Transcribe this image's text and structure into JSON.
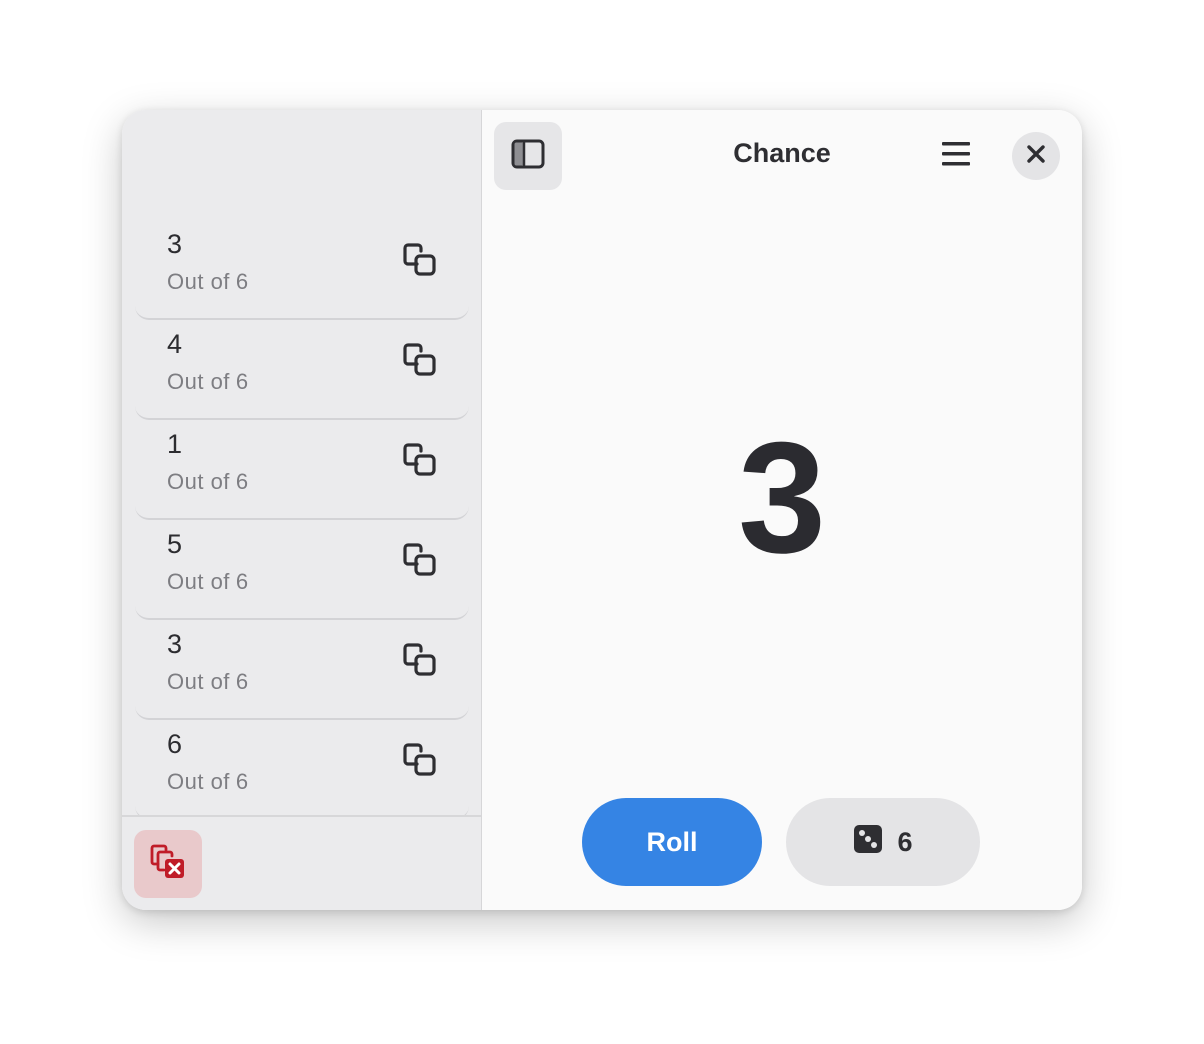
{
  "app": {
    "title": "Chance"
  },
  "sidebar": {
    "history": [
      {
        "value": "3",
        "out_of_label": "Out of",
        "max": "6"
      },
      {
        "value": "4",
        "out_of_label": "Out of",
        "max": "6"
      },
      {
        "value": "1",
        "out_of_label": "Out of",
        "max": "6"
      },
      {
        "value": "5",
        "out_of_label": "Out of",
        "max": "6"
      },
      {
        "value": "3",
        "out_of_label": "Out of",
        "max": "6"
      },
      {
        "value": "6",
        "out_of_label": "Out of",
        "max": "6"
      }
    ],
    "row_icon": "copy-icon",
    "footer_icon": "clear-history-icon"
  },
  "main": {
    "result": "3",
    "roll_label": "Roll",
    "dice_sides": "6",
    "dice_icon": "dice-icon"
  },
  "colors": {
    "accent": "#3584e4",
    "destructive": "#c01c28",
    "destructive_bg": "#e9c9cb"
  }
}
